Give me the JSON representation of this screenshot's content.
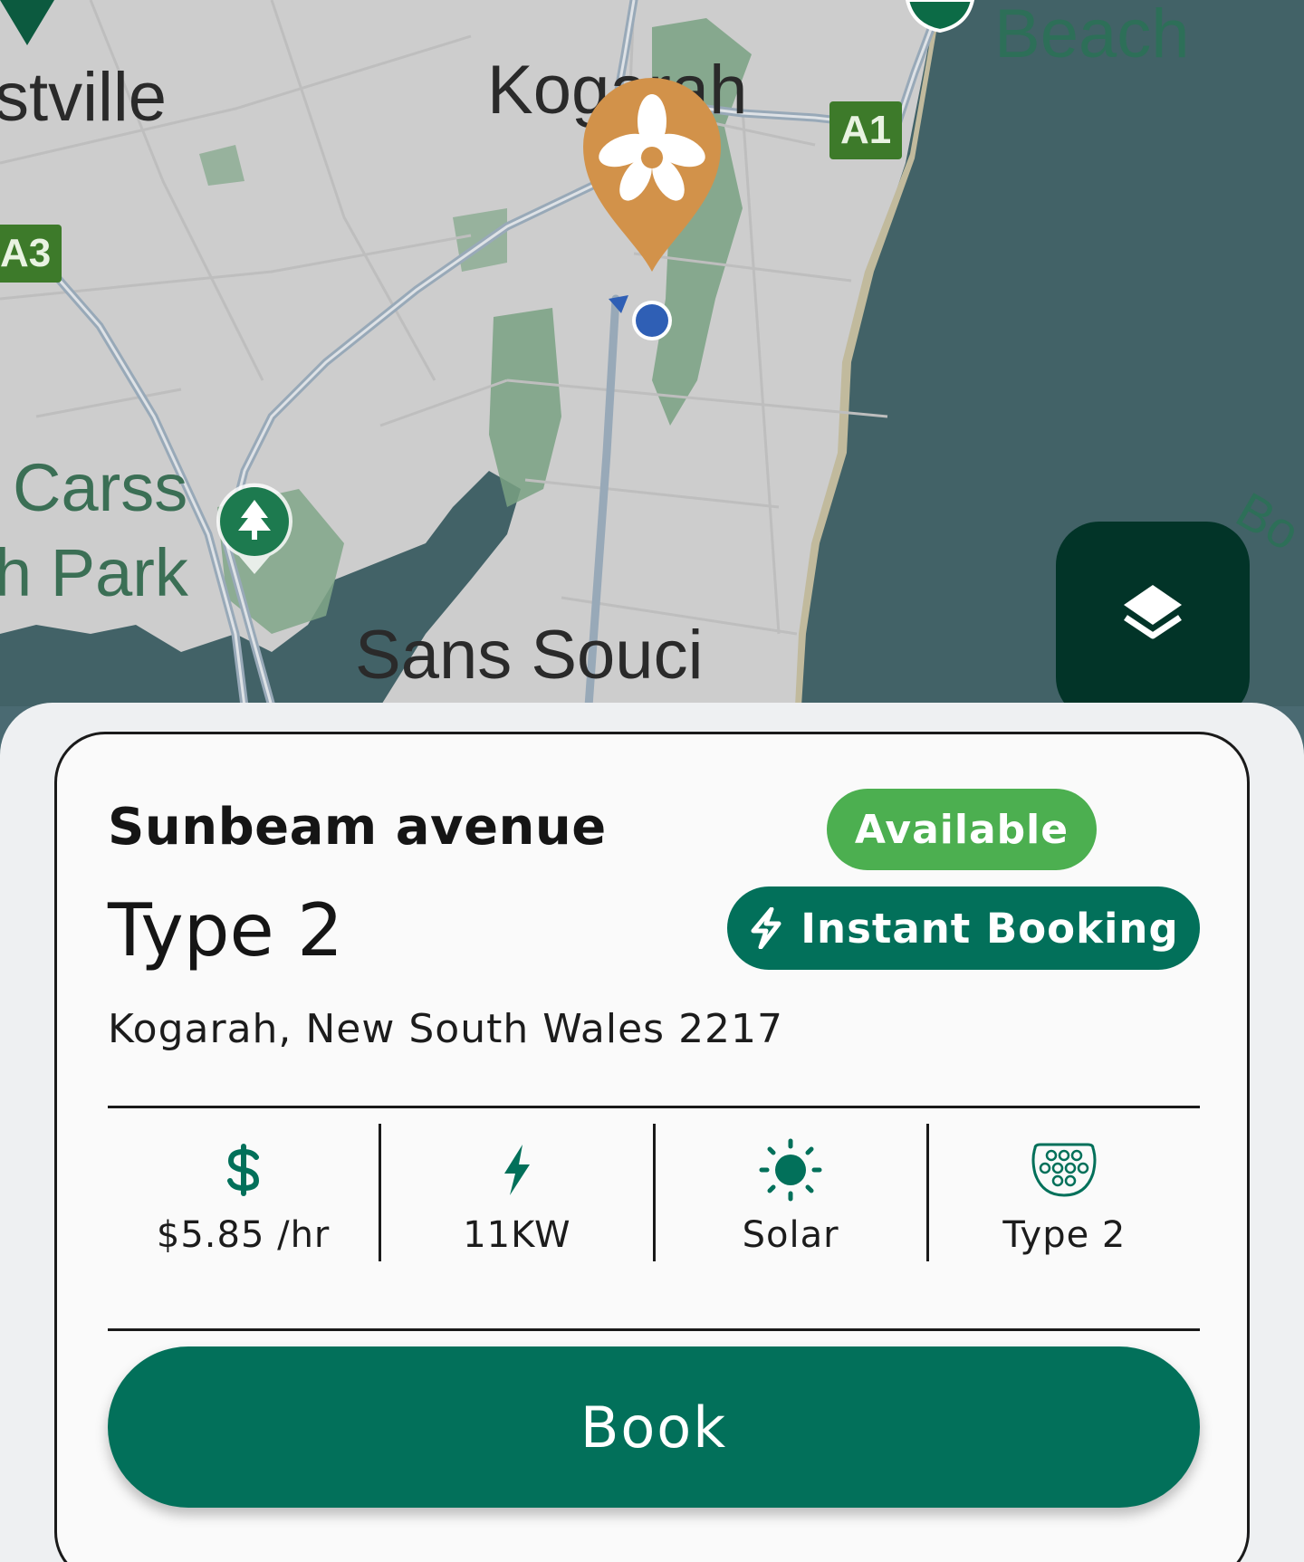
{
  "map": {
    "labels": {
      "hurstville": "stville",
      "kogarah": "Kogarah",
      "beach": "Beach",
      "carss_line1": "Carss",
      "carss_line2": "h Park",
      "sans_souci": "Sans Souci",
      "bo": "Bo"
    },
    "shields": {
      "a1": "A1",
      "a3": "A3"
    },
    "icons": {
      "charger_pin": "orange-flower-pin-icon",
      "location_dot": "blue-location-dot-icon",
      "park_pin": "tree-pin-icon",
      "layers": "layers-icon"
    },
    "colors": {
      "water": "#45666c",
      "land": "#d6d6d6",
      "park": "#7fa888",
      "pin": "#d2924a",
      "layers_bg": "#023428"
    }
  },
  "station": {
    "name": "Sunbeam avenue",
    "connector_title": "Type 2",
    "address": "Kogarah, New South Wales 2217",
    "status_badge": "Available",
    "instant_badge": "Instant Booking",
    "features": [
      {
        "icon": "dollar-icon",
        "label": "$5.85 /hr"
      },
      {
        "icon": "bolt-icon",
        "label": "11KW"
      },
      {
        "icon": "sun-icon",
        "label": "Solar"
      },
      {
        "icon": "type2-plug-icon",
        "label": "Type 2"
      }
    ],
    "book_label": "Book",
    "colors": {
      "primary": "#02705a",
      "available": "#4caf50"
    }
  }
}
